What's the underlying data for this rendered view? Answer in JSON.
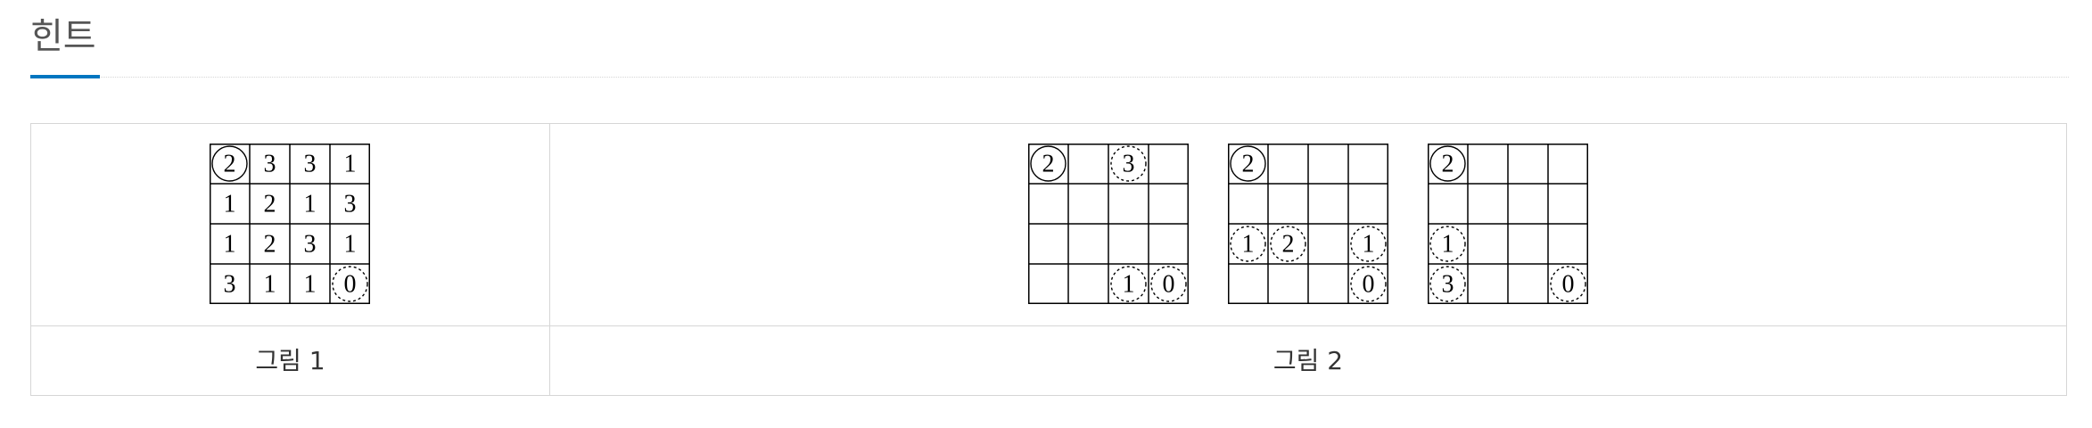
{
  "section": {
    "title": "힌트"
  },
  "captions": {
    "figure1": "그림 1",
    "figure2": "그림 2"
  },
  "grids": {
    "figure1": [
      [
        {
          "v": "2",
          "mark": "solid"
        },
        {
          "v": "3"
        },
        {
          "v": "3"
        },
        {
          "v": "1"
        }
      ],
      [
        {
          "v": "1"
        },
        {
          "v": "2"
        },
        {
          "v": "1"
        },
        {
          "v": "3"
        }
      ],
      [
        {
          "v": "1"
        },
        {
          "v": "2"
        },
        {
          "v": "3"
        },
        {
          "v": "1"
        }
      ],
      [
        {
          "v": "3"
        },
        {
          "v": "1"
        },
        {
          "v": "1"
        },
        {
          "v": "0",
          "mark": "dashed"
        }
      ]
    ],
    "figure2a": [
      [
        {
          "v": "2",
          "mark": "solid"
        },
        {},
        {
          "v": "3",
          "mark": "dashed"
        },
        {}
      ],
      [
        {},
        {},
        {},
        {}
      ],
      [
        {},
        {},
        {},
        {}
      ],
      [
        {},
        {},
        {
          "v": "1",
          "mark": "dashed"
        },
        {
          "v": "0",
          "mark": "dashed"
        }
      ]
    ],
    "figure2b": [
      [
        {
          "v": "2",
          "mark": "solid"
        },
        {},
        {},
        {}
      ],
      [
        {},
        {},
        {},
        {}
      ],
      [
        {
          "v": "1",
          "mark": "dashed"
        },
        {
          "v": "2",
          "mark": "dashed"
        },
        {},
        {
          "v": "1",
          "mark": "dashed"
        }
      ],
      [
        {},
        {},
        {},
        {
          "v": "0",
          "mark": "dashed"
        }
      ]
    ],
    "figure2c": [
      [
        {
          "v": "2",
          "mark": "solid"
        },
        {},
        {},
        {}
      ],
      [
        {},
        {},
        {},
        {}
      ],
      [
        {
          "v": "1",
          "mark": "dashed"
        },
        {},
        {},
        {}
      ],
      [
        {
          "v": "3",
          "mark": "dashed"
        },
        {},
        {},
        {
          "v": "0",
          "mark": "dashed"
        }
      ]
    ]
  },
  "colors": {
    "accent": "#0076c0",
    "grid_line": "#000000",
    "table_border": "#d6d6d6"
  }
}
